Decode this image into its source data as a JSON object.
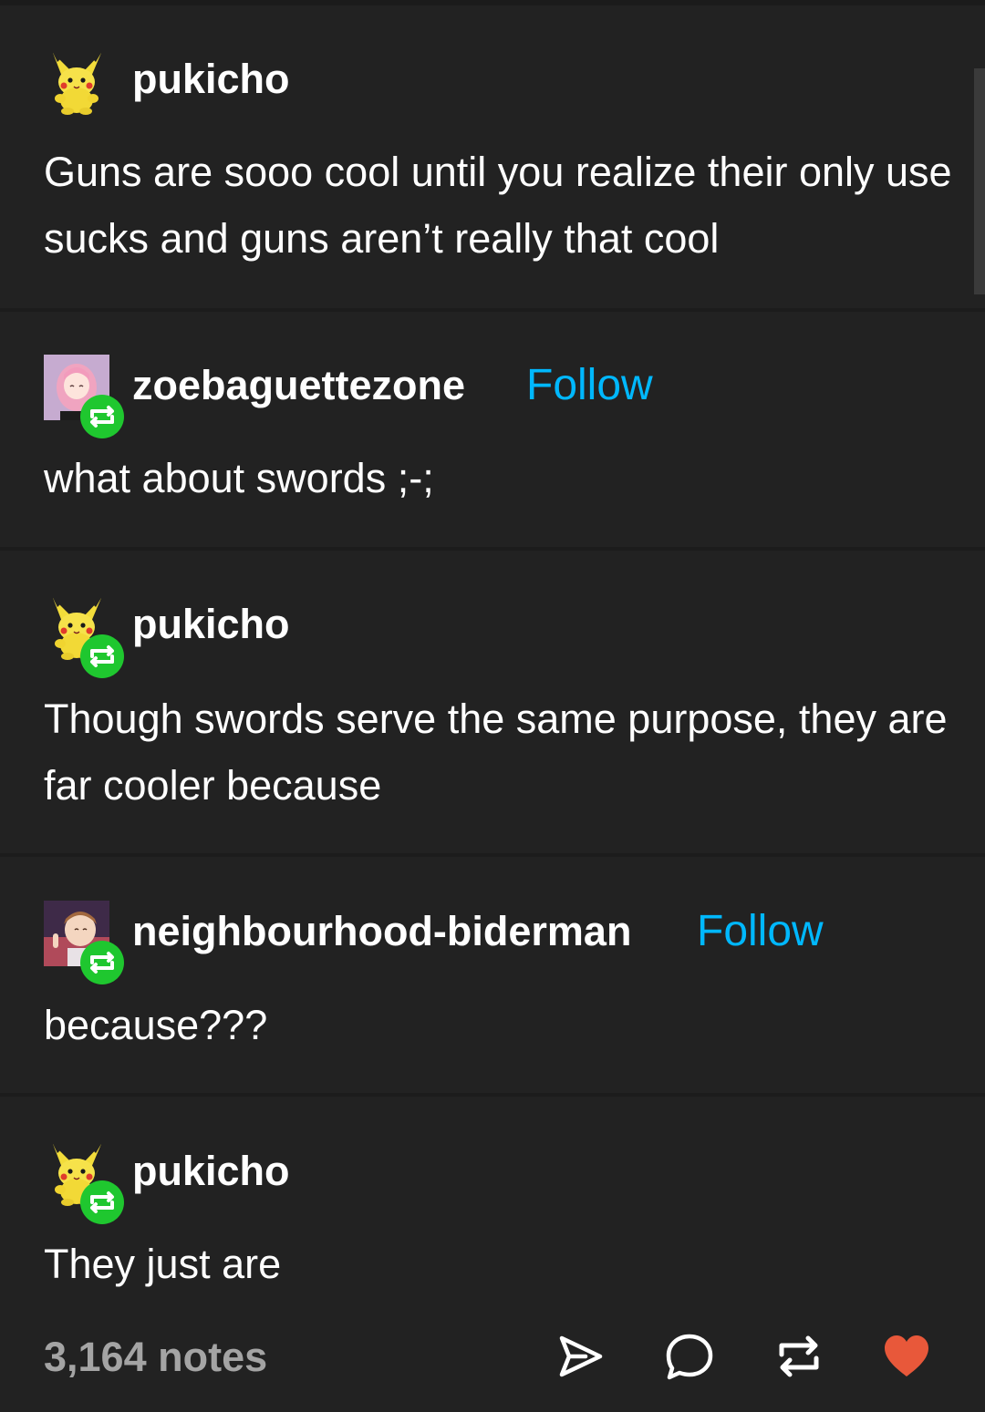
{
  "thread": [
    {
      "username": "pukicho",
      "avatar_icon": "pikachu-plush-avatar",
      "reblog_badge": false,
      "follow_label": null,
      "text": "Guns are sooo cool until you realize their only use sucks and guns aren’t really that cool"
    },
    {
      "username": "zoebaguettezone",
      "avatar_icon": "pink-haired-girl-avatar",
      "reblog_badge": true,
      "follow_label": "Follow",
      "text": "what about swords ;-;"
    },
    {
      "username": "pukicho",
      "avatar_icon": "pikachu-plush-avatar",
      "reblog_badge": true,
      "follow_label": null,
      "text": "Though swords serve the same purpose, they are far cooler because"
    },
    {
      "username": "neighbourhood-biderman",
      "avatar_icon": "brown-haired-boy-avatar",
      "reblog_badge": true,
      "follow_label": "Follow",
      "text": "because???"
    },
    {
      "username": "pukicho",
      "avatar_icon": "pikachu-plush-avatar",
      "reblog_badge": true,
      "follow_label": null,
      "text": "They just are"
    }
  ],
  "footer": {
    "notes": "3,164 notes",
    "actions": [
      "share-icon",
      "reply-icon",
      "reblog-icon",
      "like-heart-icon"
    ]
  },
  "colors": {
    "background": "#222222",
    "follow": "#00b8ff",
    "reblog_badge": "#1fc72f",
    "like": "#e8583a",
    "notes": "#a4a4a4"
  }
}
